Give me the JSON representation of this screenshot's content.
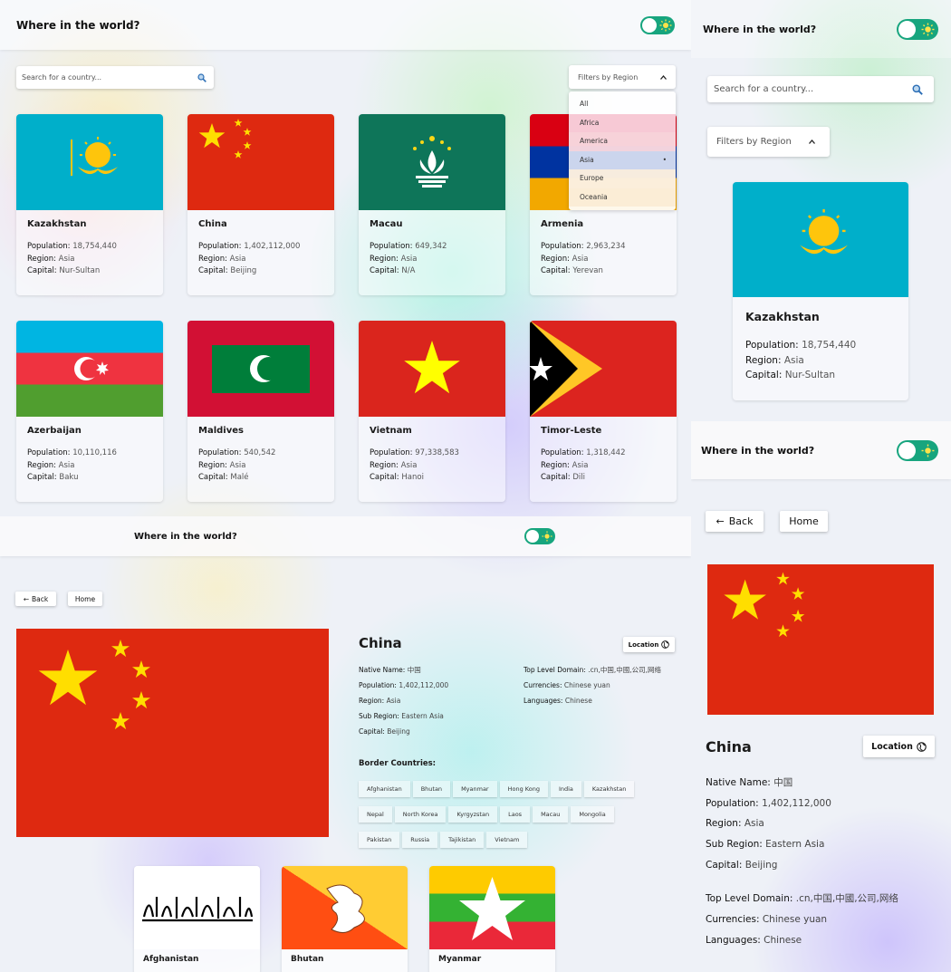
{
  "app_title": "Where in the world?",
  "search_placeholder": "Search for a country...",
  "filter_label": "Filters by Region",
  "regions": [
    "All",
    "Africa",
    "America",
    "Asia",
    "Europe",
    "Oceania"
  ],
  "selected_region": "Asia",
  "labels": {
    "population": "Population:",
    "region": "Region:",
    "capital": "Capital:"
  },
  "countries": [
    {
      "name": "Kazakhstan",
      "population": "18,754,440",
      "region": "Asia",
      "capital": "Nur-Sultan"
    },
    {
      "name": "China",
      "population": "1,402,112,000",
      "region": "Asia",
      "capital": "Beijing"
    },
    {
      "name": "Macau",
      "population": "649,342",
      "region": "Asia",
      "capital": "N/A"
    },
    {
      "name": "Armenia",
      "population": "2,963,234",
      "region": "Asia",
      "capital": "Yerevan"
    },
    {
      "name": "Azerbaijan",
      "population": "10,110,116",
      "region": "Asia",
      "capital": "Baku"
    },
    {
      "name": "Maldives",
      "population": "540,542",
      "region": "Asia",
      "capital": "Malé"
    },
    {
      "name": "Vietnam",
      "population": "97,338,583",
      "region": "Asia",
      "capital": "Hanoi"
    },
    {
      "name": "Timor-Leste",
      "population": "1,318,442",
      "region": "Asia",
      "capital": "Dili"
    }
  ],
  "detail": {
    "back_label": "Back",
    "home_label": "Home",
    "location_label": "Location",
    "name": "China",
    "native_name_label": "Native Name:",
    "native_name": "中国",
    "population_label": "Population:",
    "population": "1,402,112,000",
    "region_label": "Region:",
    "region": "Asia",
    "sub_region_label": "Sub Region:",
    "sub_region": "Eastern Asia",
    "capital_label": "Capital:",
    "capital": "Beijing",
    "tld_label": "Top Level Domain:",
    "tld": ".cn,中国,中國,公司,网络",
    "currencies_label": "Currencies:",
    "currencies": "Chinese yuan",
    "languages_label": "Languages:",
    "languages": "Chinese",
    "border_label": "Border Countries:",
    "borders": [
      "Afghanistan",
      "Bhutan",
      "Myanmar",
      "Hong Kong",
      "India",
      "Kazakhstan",
      "Nepal",
      "North Korea",
      "Kyrgyzstan",
      "Laos",
      "Macau",
      "Mongolia",
      "Pakistan",
      "Russia",
      "Tajikistan",
      "Vietnam"
    ]
  },
  "border_cards": [
    "Afghanistan",
    "Bhutan",
    "Myanmar"
  ],
  "colors": {
    "accent": "#17a57e",
    "china_red": "#de2910",
    "star_yellow": "#ffde00"
  }
}
